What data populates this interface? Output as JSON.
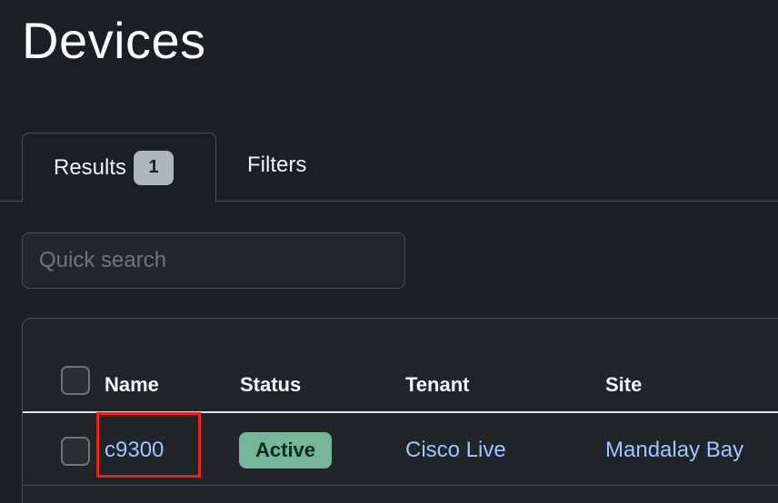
{
  "page": {
    "title": "Devices"
  },
  "tabs": {
    "results_label": "Results",
    "results_count": "1",
    "filters_label": "Filters"
  },
  "search": {
    "placeholder": "Quick search",
    "value": ""
  },
  "table": {
    "columns": [
      "Name",
      "Status",
      "Tenant",
      "Site"
    ],
    "rows": [
      {
        "name": "c9300",
        "status": "Active",
        "tenant": "Cisco Live",
        "site": "Mandalay Bay"
      }
    ]
  },
  "colors": {
    "background": "#1b1e22",
    "link": "#9ec5fe",
    "status_active": "#75b798",
    "highlight": "#e8211a"
  }
}
